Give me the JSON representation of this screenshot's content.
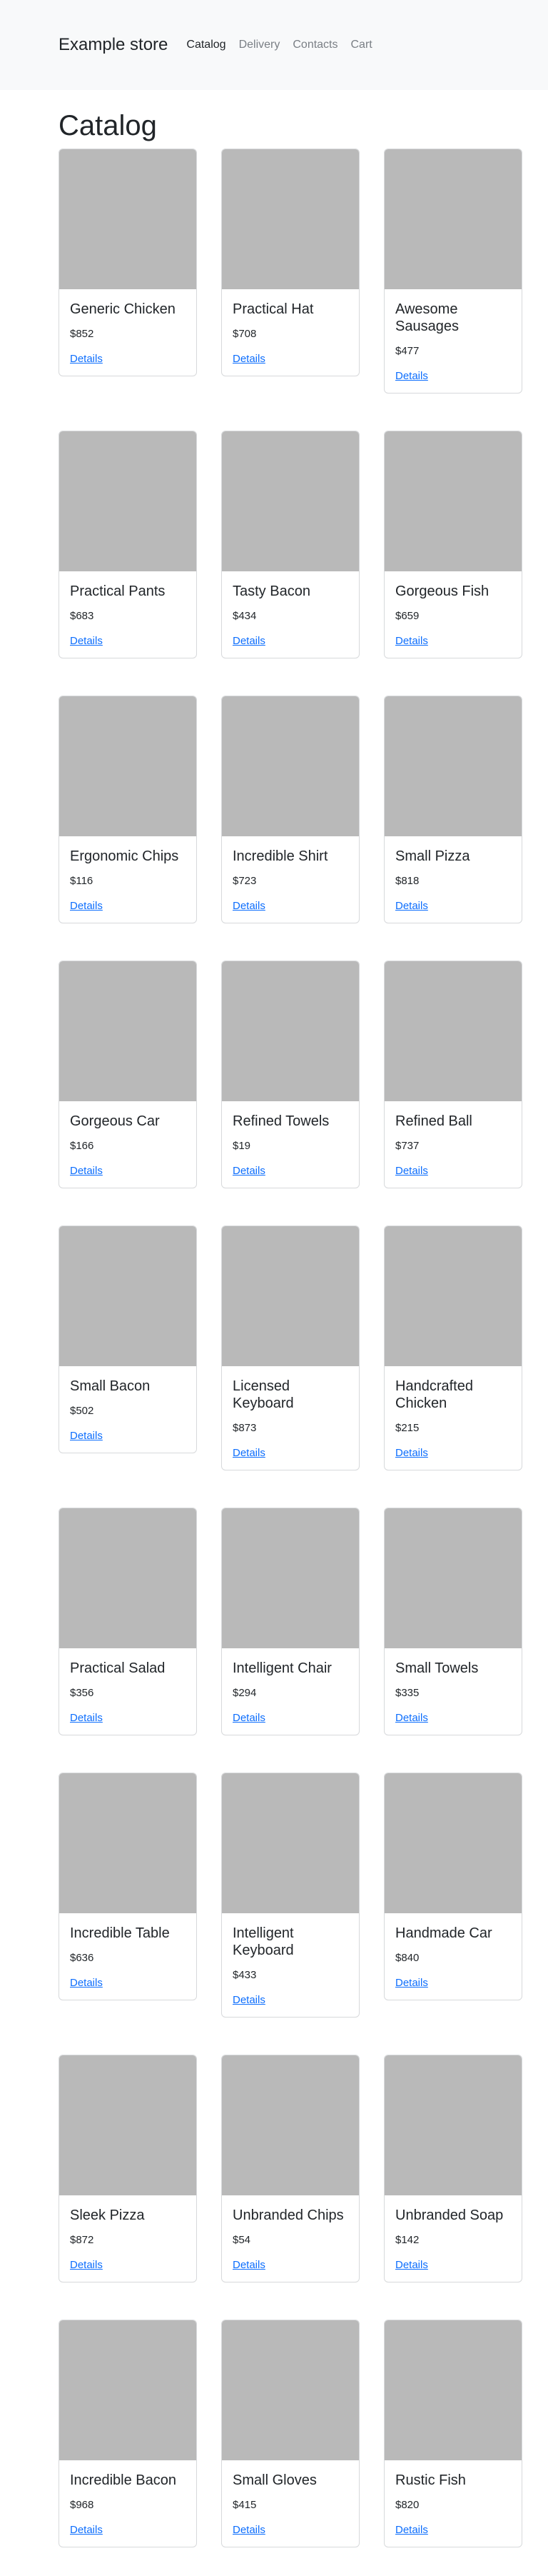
{
  "navbar": {
    "brand": "Example store",
    "links": [
      {
        "label": "Catalog",
        "active": true
      },
      {
        "label": "Delivery",
        "active": false
      },
      {
        "label": "Contacts",
        "active": false
      },
      {
        "label": "Cart",
        "active": false
      }
    ]
  },
  "page": {
    "title": "Catalog"
  },
  "colors": {
    "placeholder_image": "#b9b9b9",
    "link": "#0d6efd",
    "navbar_bg": "#f8f9fa"
  },
  "products": [
    {
      "name": "Generic Chicken",
      "price": "$852",
      "link": "Details"
    },
    {
      "name": "Practical Hat",
      "price": "$708",
      "link": "Details"
    },
    {
      "name": "Awesome Sausages",
      "price": "$477",
      "link": "Details"
    },
    {
      "name": "Practical Pants",
      "price": "$683",
      "link": "Details"
    },
    {
      "name": "Tasty Bacon",
      "price": "$434",
      "link": "Details"
    },
    {
      "name": "Gorgeous Fish",
      "price": "$659",
      "link": "Details"
    },
    {
      "name": "Ergonomic Chips",
      "price": "$116",
      "link": "Details"
    },
    {
      "name": "Incredible Shirt",
      "price": "$723",
      "link": "Details"
    },
    {
      "name": "Small Pizza",
      "price": "$818",
      "link": "Details"
    },
    {
      "name": "Gorgeous Car",
      "price": "$166",
      "link": "Details"
    },
    {
      "name": "Refined Towels",
      "price": "$19",
      "link": "Details"
    },
    {
      "name": "Refined Ball",
      "price": "$737",
      "link": "Details"
    },
    {
      "name": "Small Bacon",
      "price": "$502",
      "link": "Details"
    },
    {
      "name": "Licensed Keyboard",
      "price": "$873",
      "link": "Details"
    },
    {
      "name": "Handcrafted Chicken",
      "price": "$215",
      "link": "Details"
    },
    {
      "name": "Practical Salad",
      "price": "$356",
      "link": "Details"
    },
    {
      "name": "Intelligent Chair",
      "price": "$294",
      "link": "Details"
    },
    {
      "name": "Small Towels",
      "price": "$335",
      "link": "Details"
    },
    {
      "name": "Incredible Table",
      "price": "$636",
      "link": "Details"
    },
    {
      "name": "Intelligent Keyboard",
      "price": "$433",
      "link": "Details"
    },
    {
      "name": "Handmade Car",
      "price": "$840",
      "link": "Details"
    },
    {
      "name": "Sleek Pizza",
      "price": "$872",
      "link": "Details"
    },
    {
      "name": "Unbranded Chips",
      "price": "$54",
      "link": "Details"
    },
    {
      "name": "Unbranded Soap",
      "price": "$142",
      "link": "Details"
    },
    {
      "name": "Incredible Bacon",
      "price": "$968",
      "link": "Details"
    },
    {
      "name": "Small Gloves",
      "price": "$415",
      "link": "Details"
    },
    {
      "name": "Rustic Fish",
      "price": "$820",
      "link": "Details"
    }
  ]
}
